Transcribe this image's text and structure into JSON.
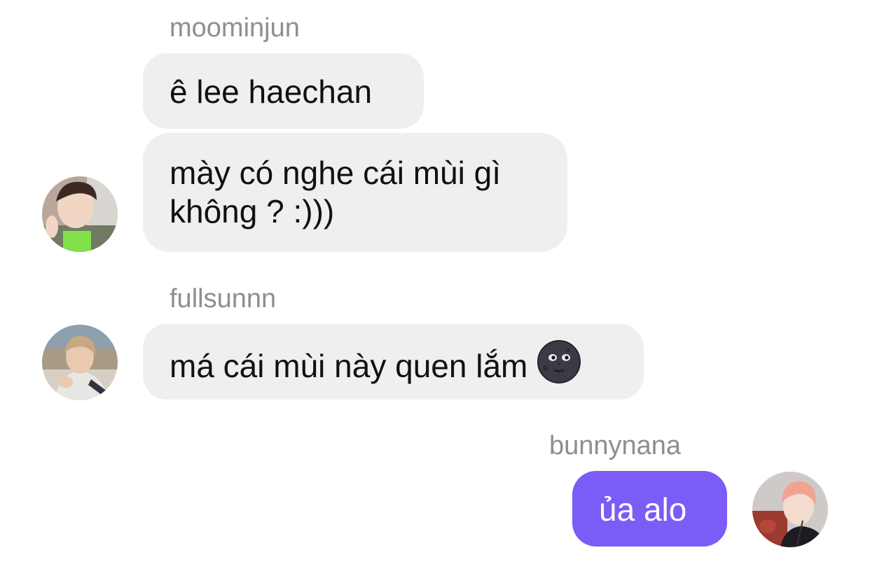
{
  "messages": [
    {
      "sender": "moominjun",
      "bubbles": [
        {
          "lines": [
            "ê lee haechan"
          ]
        },
        {
          "lines": [
            "mày có nghe cái mùi gì",
            "không ? :)))"
          ]
        }
      ],
      "avatar_icon": "user-avatar-icon"
    },
    {
      "sender": "fullsunnn",
      "bubbles": [
        {
          "lines": [
            "má cái mùi này quen lắm"
          ],
          "emoji": "new-moon-face-icon"
        }
      ],
      "avatar_icon": "user-avatar-icon"
    },
    {
      "sender": "bunnynana",
      "bubbles": [
        {
          "lines": [
            "ủa alo"
          ]
        }
      ],
      "avatar_icon": "user-avatar-icon",
      "outgoing": true
    }
  ],
  "colors": {
    "incoming_bubble": "#efefef",
    "outgoing_bubble": "#7b5cf7",
    "sender_text": "#8e8e93"
  }
}
